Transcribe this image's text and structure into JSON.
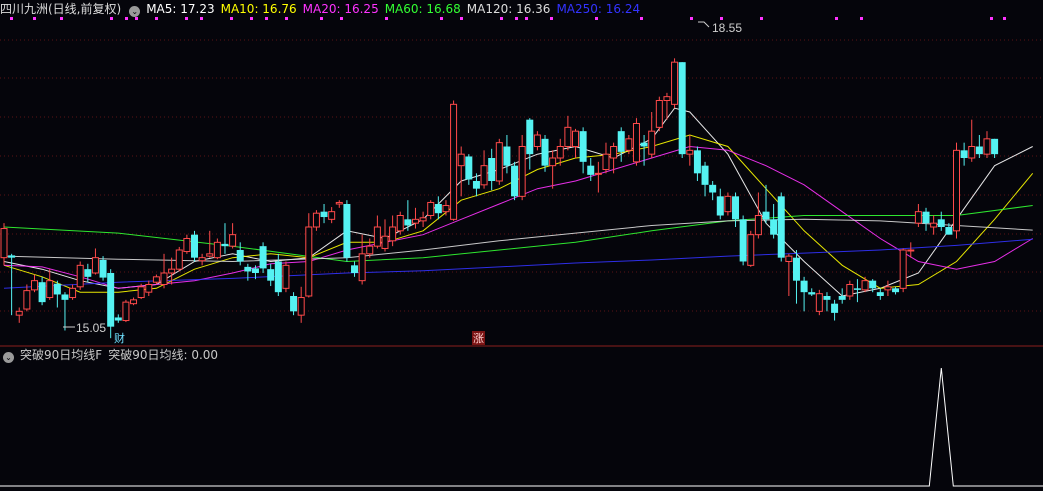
{
  "header": {
    "title": "四川九洲(日线,前复权)",
    "indicators": [
      {
        "label": "MA5: 17.23",
        "color": "#ffffff"
      },
      {
        "label": "MA10: 16.76",
        "color": "#ffff00"
      },
      {
        "label": "MA20: 16.25",
        "color": "#ff33ff"
      },
      {
        "label": "MA60: 16.68",
        "color": "#33ff33"
      },
      {
        "label": "MA120: 16.36",
        "color": "#dddddd"
      },
      {
        "label": "MA250: 16.24",
        "color": "#3333ff"
      }
    ]
  },
  "sub_header": {
    "name": "突破90日均线F",
    "value_label": "突破90日均线: 0.00"
  },
  "markers": {
    "caifu": "财",
    "zhang": "涨",
    "high_label": "18.55",
    "low_label": "15.05"
  },
  "colors": {
    "up": "#ff4a4a",
    "down": "#55f2f2",
    "bg": "#05050b",
    "grid": "#5a1414"
  },
  "chart_data": {
    "type": "candlestick",
    "price_range": [
      14.9,
      19.1
    ],
    "candles": [
      [
        16.0,
        16.38,
        15.9,
        16.45
      ],
      [
        16.03,
        16.0,
        15.25,
        16.05
      ],
      [
        15.25,
        15.3,
        15.15,
        15.35
      ],
      [
        15.33,
        15.57,
        15.3,
        15.65
      ],
      [
        15.58,
        15.7,
        15.55,
        15.78
      ],
      [
        15.68,
        15.42,
        15.38,
        15.75
      ],
      [
        15.48,
        15.7,
        15.45,
        15.85
      ],
      [
        15.66,
        15.52,
        15.35,
        15.7
      ],
      [
        15.52,
        15.45,
        15.05,
        15.55
      ],
      [
        15.48,
        15.6,
        15.45,
        15.65
      ],
      [
        15.62,
        15.9,
        15.58,
        15.95
      ],
      [
        15.85,
        15.75,
        15.68,
        15.92
      ],
      [
        15.8,
        16.0,
        15.78,
        16.12
      ],
      [
        15.97,
        15.74,
        15.7,
        16.02
      ],
      [
        15.8,
        15.1,
        14.95,
        15.85
      ],
      [
        15.22,
        15.18,
        15.15,
        15.26
      ],
      [
        15.18,
        15.42,
        15.16,
        15.45
      ],
      [
        15.4,
        15.45,
        15.38,
        15.48
      ],
      [
        15.48,
        15.62,
        15.46,
        15.66
      ],
      [
        15.55,
        15.65,
        15.5,
        15.7
      ],
      [
        15.68,
        15.75,
        15.65,
        15.78
      ],
      [
        15.65,
        15.8,
        15.6,
        16.05
      ],
      [
        15.8,
        15.85,
        15.65,
        16.0
      ],
      [
        15.85,
        16.1,
        15.82,
        16.14
      ],
      [
        16.08,
        16.25,
        16.05,
        16.3
      ],
      [
        16.3,
        16.0,
        15.95,
        16.35
      ],
      [
        15.96,
        16.0,
        15.9,
        16.05
      ],
      [
        16.02,
        16.05,
        16.0,
        16.35
      ],
      [
        16.0,
        16.2,
        15.98,
        16.25
      ],
      [
        16.18,
        16.15,
        16.05,
        16.45
      ],
      [
        16.15,
        16.3,
        16.12,
        16.45
      ],
      [
        16.1,
        15.95,
        15.9,
        16.2
      ],
      [
        15.88,
        15.82,
        15.7,
        15.92
      ],
      [
        15.86,
        15.8,
        15.72,
        15.9
      ],
      [
        16.15,
        15.86,
        15.8,
        16.2
      ],
      [
        15.85,
        15.7,
        15.63,
        15.92
      ],
      [
        15.95,
        15.55,
        15.5,
        16.05
      ],
      [
        15.6,
        15.9,
        15.55,
        15.95
      ],
      [
        15.5,
        15.3,
        15.25,
        15.55
      ],
      [
        15.25,
        15.48,
        15.15,
        15.62
      ],
      [
        15.5,
        16.4,
        15.48,
        16.58
      ],
      [
        16.4,
        16.58,
        16.35,
        16.62
      ],
      [
        16.6,
        16.53,
        16.45,
        16.7
      ],
      [
        16.5,
        16.6,
        16.45,
        16.66
      ],
      [
        16.7,
        16.72,
        16.65,
        16.75
      ],
      [
        16.7,
        16.0,
        15.95,
        16.75
      ],
      [
        15.9,
        15.8,
        15.75,
        15.95
      ],
      [
        15.7,
        16.05,
        15.65,
        16.3
      ],
      [
        16.05,
        16.15,
        16.0,
        16.25
      ],
      [
        16.15,
        16.4,
        16.12,
        16.55
      ],
      [
        16.12,
        16.28,
        16.08,
        16.5
      ],
      [
        16.22,
        16.4,
        16.15,
        16.55
      ],
      [
        16.35,
        16.55,
        16.3,
        16.6
      ],
      [
        16.5,
        16.42,
        16.35,
        16.75
      ],
      [
        16.45,
        16.5,
        16.38,
        16.65
      ],
      [
        16.48,
        16.52,
        16.4,
        16.6
      ],
      [
        16.55,
        16.72,
        16.5,
        16.75
      ],
      [
        16.7,
        16.58,
        16.5,
        16.8
      ],
      [
        16.6,
        16.68,
        16.55,
        16.75
      ],
      [
        16.5,
        18.0,
        16.48,
        18.05
      ],
      [
        17.2,
        17.35,
        16.8,
        17.45
      ],
      [
        17.32,
        17.02,
        16.95,
        17.35
      ],
      [
        17.0,
        16.9,
        16.8,
        17.1
      ],
      [
        16.95,
        17.2,
        16.9,
        17.4
      ],
      [
        17.3,
        17.0,
        16.88,
        17.42
      ],
      [
        17.0,
        17.5,
        16.95,
        17.55
      ],
      [
        17.45,
        17.2,
        17.1,
        17.6
      ],
      [
        17.2,
        16.8,
        16.75,
        17.25
      ],
      [
        16.8,
        17.45,
        16.75,
        17.6
      ],
      [
        17.8,
        17.35,
        17.15,
        17.82
      ],
      [
        17.45,
        17.6,
        17.4,
        17.65
      ],
      [
        17.55,
        17.2,
        17.12,
        17.6
      ],
      [
        17.2,
        17.3,
        16.9,
        17.4
      ],
      [
        17.3,
        17.45,
        17.2,
        17.55
      ],
      [
        17.45,
        17.7,
        17.4,
        17.85
      ],
      [
        17.45,
        17.65,
        17.3,
        17.68
      ],
      [
        17.65,
        17.25,
        17.1,
        17.7
      ],
      [
        17.2,
        17.08,
        17.0,
        17.3
      ],
      [
        17.1,
        17.1,
        16.85,
        17.25
      ],
      [
        17.15,
        17.35,
        17.1,
        17.5
      ],
      [
        17.3,
        17.45,
        17.1,
        17.5
      ],
      [
        17.65,
        17.38,
        17.25,
        17.7
      ],
      [
        17.4,
        17.55,
        17.35,
        17.6
      ],
      [
        17.25,
        17.75,
        17.2,
        17.82
      ],
      [
        17.5,
        17.45,
        17.2,
        17.6
      ],
      [
        17.35,
        17.65,
        17.3,
        17.9
      ],
      [
        17.7,
        18.05,
        17.65,
        18.1
      ],
      [
        18.05,
        18.1,
        17.8,
        18.15
      ],
      [
        18.0,
        18.55,
        17.95,
        18.6
      ],
      [
        18.55,
        17.35,
        17.3,
        18.55
      ],
      [
        17.35,
        17.4,
        17.2,
        17.6
      ],
      [
        17.4,
        17.1,
        17.0,
        17.45
      ],
      [
        17.2,
        16.95,
        16.8,
        17.25
      ],
      [
        16.95,
        16.85,
        16.75,
        17.0
      ],
      [
        16.8,
        16.55,
        16.5,
        16.9
      ],
      [
        16.6,
        16.8,
        16.55,
        16.85
      ],
      [
        16.8,
        16.5,
        16.4,
        16.85
      ],
      [
        16.5,
        15.95,
        15.9,
        16.55
      ],
      [
        15.9,
        16.3,
        15.88,
        16.35
      ],
      [
        16.3,
        16.55,
        16.25,
        16.85
      ],
      [
        16.6,
        16.5,
        16.45,
        16.95
      ],
      [
        16.5,
        16.3,
        16.25,
        16.7
      ],
      [
        16.8,
        16.0,
        15.95,
        16.85
      ],
      [
        15.95,
        16.02,
        15.5,
        16.05
      ],
      [
        16.0,
        15.7,
        15.4,
        16.1
      ],
      [
        15.7,
        15.55,
        15.3,
        15.75
      ],
      [
        15.55,
        15.52,
        15.5,
        15.6
      ],
      [
        15.3,
        15.53,
        15.25,
        15.58
      ],
      [
        15.5,
        15.45,
        15.3,
        15.55
      ],
      [
        15.4,
        15.28,
        15.18,
        15.45
      ],
      [
        15.5,
        15.45,
        15.4,
        15.6
      ],
      [
        15.5,
        15.65,
        15.45,
        15.7
      ],
      [
        15.6,
        15.58,
        15.42,
        15.72
      ],
      [
        15.58,
        15.7,
        15.55,
        15.75
      ],
      [
        15.7,
        15.6,
        15.55,
        15.72
      ],
      [
        15.55,
        15.5,
        15.45,
        15.6
      ],
      [
        15.58,
        15.62,
        15.5,
        15.7
      ],
      [
        15.6,
        15.55,
        15.52,
        15.62
      ],
      [
        15.6,
        16.1,
        15.55,
        16.12
      ],
      [
        16.1,
        16.1,
        16.0,
        16.2
      ],
      [
        16.45,
        16.6,
        16.4,
        16.7
      ],
      [
        16.6,
        16.45,
        16.35,
        16.65
      ],
      [
        16.4,
        16.45,
        16.3,
        16.55
      ],
      [
        16.5,
        16.4,
        16.35,
        16.6
      ],
      [
        16.4,
        16.3,
        16.3,
        16.45
      ],
      [
        16.35,
        17.4,
        16.25,
        17.5
      ],
      [
        17.4,
        17.3,
        17.2,
        17.5
      ],
      [
        17.3,
        17.45,
        17.25,
        17.8
      ],
      [
        17.45,
        17.35,
        17.3,
        17.6
      ],
      [
        17.35,
        17.55,
        17.3,
        17.65
      ],
      [
        17.55,
        17.35,
        17.3,
        17.55
      ]
    ],
    "ma_series": [
      {
        "name": "MA5",
        "color": "#ffffff",
        "values": [
          [
            0,
            15.95
          ],
          [
            5,
            15.85
          ],
          [
            10,
            15.7
          ],
          [
            15,
            15.6
          ],
          [
            20,
            15.65
          ],
          [
            25,
            15.95
          ],
          [
            30,
            16.05
          ],
          [
            35,
            15.95
          ],
          [
            40,
            16.0
          ],
          [
            45,
            16.35
          ],
          [
            50,
            16.25
          ],
          [
            55,
            16.5
          ],
          [
            60,
            17.0
          ],
          [
            65,
            17.15
          ],
          [
            70,
            17.35
          ],
          [
            75,
            17.45
          ],
          [
            80,
            17.3
          ],
          [
            85,
            17.55
          ],
          [
            88,
            17.95
          ],
          [
            90,
            17.9
          ],
          [
            95,
            17.35
          ],
          [
            100,
            16.45
          ],
          [
            105,
            15.95
          ],
          [
            110,
            15.5
          ],
          [
            115,
            15.6
          ],
          [
            120,
            15.8
          ],
          [
            125,
            16.5
          ],
          [
            130,
            17.2
          ],
          [
            135,
            17.45
          ]
        ]
      },
      {
        "name": "MA10",
        "color": "#ffff00",
        "values": [
          [
            0,
            15.9
          ],
          [
            5,
            15.75
          ],
          [
            10,
            15.55
          ],
          [
            15,
            15.55
          ],
          [
            20,
            15.6
          ],
          [
            25,
            15.85
          ],
          [
            30,
            16.0
          ],
          [
            35,
            16.05
          ],
          [
            40,
            16.0
          ],
          [
            45,
            16.2
          ],
          [
            50,
            16.2
          ],
          [
            55,
            16.35
          ],
          [
            60,
            16.75
          ],
          [
            65,
            16.9
          ],
          [
            70,
            17.15
          ],
          [
            75,
            17.3
          ],
          [
            80,
            17.35
          ],
          [
            85,
            17.45
          ],
          [
            90,
            17.6
          ],
          [
            95,
            17.45
          ],
          [
            100,
            16.9
          ],
          [
            105,
            16.35
          ],
          [
            110,
            15.9
          ],
          [
            115,
            15.6
          ],
          [
            120,
            15.65
          ],
          [
            125,
            15.95
          ],
          [
            130,
            16.5
          ],
          [
            135,
            17.1
          ]
        ]
      },
      {
        "name": "MA20",
        "color": "#ff33ff",
        "values": [
          [
            0,
            15.9
          ],
          [
            5,
            15.88
          ],
          [
            10,
            15.75
          ],
          [
            15,
            15.6
          ],
          [
            20,
            15.65
          ],
          [
            25,
            15.7
          ],
          [
            30,
            15.8
          ],
          [
            35,
            15.92
          ],
          [
            40,
            15.95
          ],
          [
            45,
            16.1
          ],
          [
            50,
            16.2
          ],
          [
            55,
            16.3
          ],
          [
            60,
            16.5
          ],
          [
            65,
            16.7
          ],
          [
            70,
            16.9
          ],
          [
            75,
            17.0
          ],
          [
            80,
            17.15
          ],
          [
            85,
            17.3
          ],
          [
            90,
            17.45
          ],
          [
            95,
            17.4
          ],
          [
            100,
            17.2
          ],
          [
            105,
            16.95
          ],
          [
            110,
            16.6
          ],
          [
            115,
            16.25
          ],
          [
            120,
            15.95
          ],
          [
            125,
            15.85
          ],
          [
            130,
            15.95
          ],
          [
            135,
            16.25
          ]
        ]
      },
      {
        "name": "MA60",
        "color": "#33ff33",
        "values": [
          [
            0,
            16.4
          ],
          [
            15,
            16.32
          ],
          [
            30,
            16.15
          ],
          [
            45,
            15.95
          ],
          [
            55,
            16.0
          ],
          [
            65,
            16.1
          ],
          [
            75,
            16.2
          ],
          [
            85,
            16.35
          ],
          [
            95,
            16.48
          ],
          [
            105,
            16.55
          ],
          [
            115,
            16.55
          ],
          [
            125,
            16.55
          ],
          [
            135,
            16.68
          ]
        ]
      },
      {
        "name": "MA120",
        "color": "#dddddd",
        "values": [
          [
            0,
            16.02
          ],
          [
            15,
            15.98
          ],
          [
            30,
            15.95
          ],
          [
            45,
            16.0
          ],
          [
            55,
            16.1
          ],
          [
            65,
            16.22
          ],
          [
            75,
            16.32
          ],
          [
            85,
            16.42
          ],
          [
            95,
            16.48
          ],
          [
            105,
            16.5
          ],
          [
            115,
            16.48
          ],
          [
            125,
            16.42
          ],
          [
            135,
            16.36
          ]
        ]
      },
      {
        "name": "MA250",
        "color": "#3333ff",
        "values": [
          [
            0,
            15.6
          ],
          [
            15,
            15.68
          ],
          [
            30,
            15.73
          ],
          [
            45,
            15.8
          ],
          [
            55,
            15.83
          ],
          [
            65,
            15.88
          ],
          [
            75,
            15.93
          ],
          [
            85,
            15.97
          ],
          [
            95,
            16.02
          ],
          [
            105,
            16.06
          ],
          [
            115,
            16.1
          ],
          [
            125,
            16.16
          ],
          [
            135,
            16.24
          ]
        ]
      }
    ],
    "sub_indicator": {
      "name": "突破90日均线",
      "values_nonzero": [
        [
          123,
          1
        ]
      ],
      "baseline": 0
    }
  }
}
